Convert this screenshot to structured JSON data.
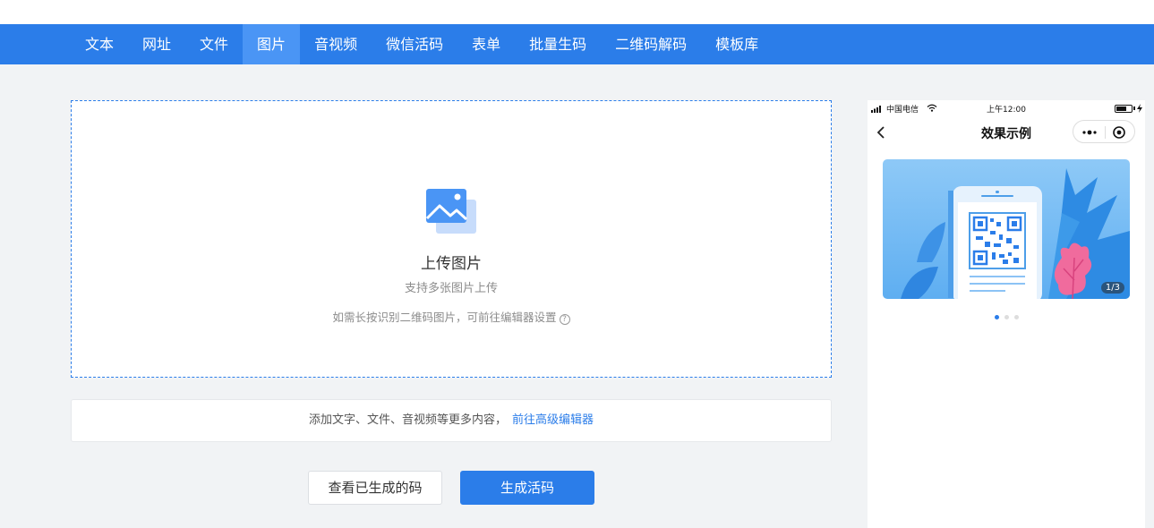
{
  "colors": {
    "primary": "#2b7de9",
    "nav_active": "#4a95f5",
    "page_bg": "#f1f3f5"
  },
  "nav": {
    "items": [
      {
        "label": "文本"
      },
      {
        "label": "网址"
      },
      {
        "label": "文件"
      },
      {
        "label": "图片",
        "active": true
      },
      {
        "label": "音视频"
      },
      {
        "label": "微信活码"
      },
      {
        "label": "表单"
      },
      {
        "label": "批量生码"
      },
      {
        "label": "二维码解码"
      },
      {
        "label": "模板库"
      }
    ]
  },
  "upload": {
    "icon": "image-icon",
    "title": "上传图片",
    "subtitle": "支持多张图片上传",
    "hint": "如需长按识别二维码图片，可前往编辑器设置",
    "help_icon": "?"
  },
  "more": {
    "text": "添加文字、文件、音视频等更多内容，",
    "link": "前往高级编辑器"
  },
  "actions": {
    "view_label": "查看已生成的码",
    "generate_label": "生成活码"
  },
  "preview": {
    "status": {
      "carrier": "中国电信",
      "time": "上午12:00"
    },
    "title": "效果示例",
    "page_indicator": "1/3",
    "slide_count": 3,
    "active_slide": 1
  }
}
